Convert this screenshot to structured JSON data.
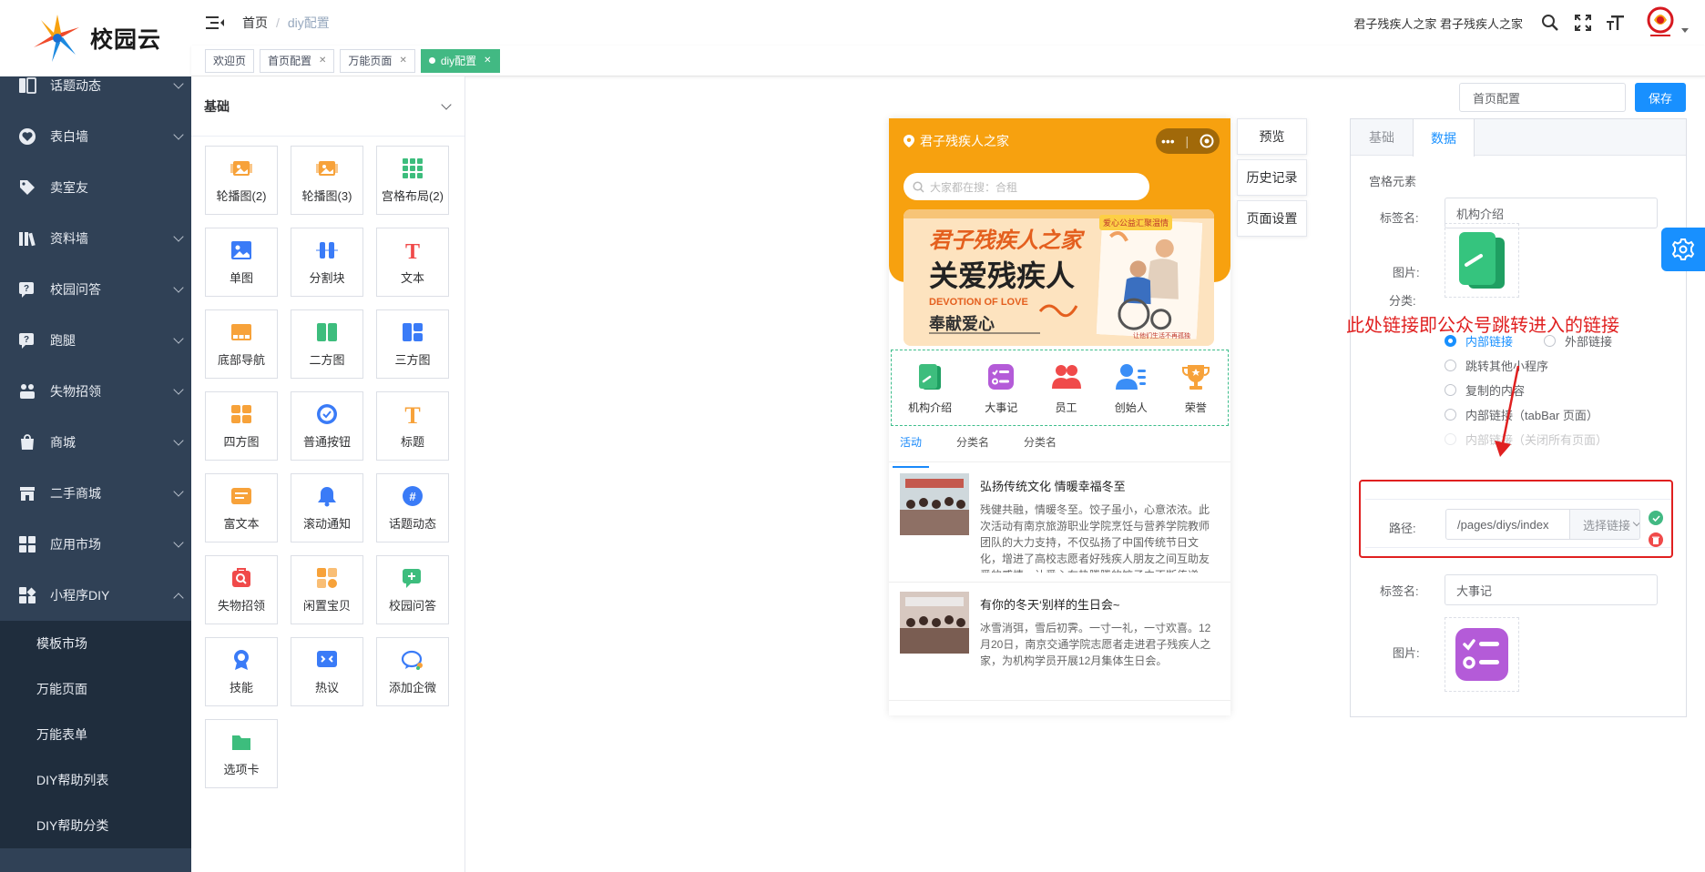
{
  "logo": {
    "text": "校园云"
  },
  "sidebar": {
    "items": [
      {
        "label": "话题动态",
        "icon": "topic-icon",
        "arrow": "down"
      },
      {
        "label": "表白墙",
        "icon": "heart-icon",
        "arrow": "down"
      },
      {
        "label": "卖室友",
        "icon": "tag-icon",
        "arrow": ""
      },
      {
        "label": "资料墙",
        "icon": "books-icon",
        "arrow": "down"
      },
      {
        "label": "校园问答",
        "icon": "qa-icon",
        "arrow": "down"
      },
      {
        "label": "跑腿",
        "icon": "errand-icon",
        "arrow": "down"
      },
      {
        "label": "失物招领",
        "icon": "lost-found-icon",
        "arrow": "down"
      },
      {
        "label": "商城",
        "icon": "shop-icon",
        "arrow": "down"
      },
      {
        "label": "二手商城",
        "icon": "store-icon",
        "arrow": "down"
      },
      {
        "label": "应用市场",
        "icon": "apps-icon",
        "arrow": "down"
      },
      {
        "label": "小程序DIY",
        "icon": "diy-icon",
        "arrow": "up"
      }
    ],
    "subitems": [
      "模板市场",
      "万能页面",
      "万能表单",
      "DIY帮助列表",
      "DIY帮助分类"
    ]
  },
  "header": {
    "breadcrumb": [
      "首页",
      "diy配置"
    ],
    "user_text": "君子残疾人之家 君子残疾人之家"
  },
  "tags": [
    {
      "label": "欢迎页",
      "closable": false,
      "active": false
    },
    {
      "label": "首页配置",
      "closable": true,
      "active": false
    },
    {
      "label": "万能页面",
      "closable": true,
      "active": false
    },
    {
      "label": "diy配置",
      "closable": true,
      "active": true
    }
  ],
  "components": {
    "section": "基础",
    "items": [
      {
        "label": "轮播图(2)",
        "icon": "carousel-icon",
        "color": "#f7a23a"
      },
      {
        "label": "轮播图(3)",
        "icon": "carousel-icon",
        "color": "#f7a23a"
      },
      {
        "label": "宫格布局(2)",
        "icon": "grid-icon",
        "color": "#3dbd7d"
      },
      {
        "label": "单图",
        "icon": "image-icon",
        "color": "#3a7bf7"
      },
      {
        "label": "分割块",
        "icon": "divider-icon",
        "color": "#3a7bf7"
      },
      {
        "label": "文本",
        "icon": "text-icon",
        "color": "#f04a4a"
      },
      {
        "label": "底部导航",
        "icon": "bottom-nav-icon",
        "color": "#f7a23a"
      },
      {
        "label": "二方图",
        "icon": "two-image-icon",
        "color": "#3dbd7d"
      },
      {
        "label": "三方图",
        "icon": "three-image-icon",
        "color": "#3a7bf7"
      },
      {
        "label": "四方图",
        "icon": "four-image-icon",
        "color": "#f7a23a"
      },
      {
        "label": "普通按钮",
        "icon": "button-icon",
        "color": "#3a7bf7"
      },
      {
        "label": "标题",
        "icon": "title-icon",
        "color": "#f7a23a"
      },
      {
        "label": "富文本",
        "icon": "rich-text-icon",
        "color": "#f7a23a"
      },
      {
        "label": "滚动通知",
        "icon": "bell-icon",
        "color": "#3a7bf7"
      },
      {
        "label": "话题动态",
        "icon": "hashtag-icon",
        "color": "#3a7bf7"
      },
      {
        "label": "失物招领",
        "icon": "lost-found-icon",
        "color": "#f04a4a"
      },
      {
        "label": "闲置宝贝",
        "icon": "idle-icon",
        "color": "#f7a23a"
      },
      {
        "label": "校园问答",
        "icon": "chat-plus-icon",
        "color": "#3dbd7d"
      },
      {
        "label": "技能",
        "icon": "badge-icon",
        "color": "#3a7bf7"
      },
      {
        "label": "热议",
        "icon": "hot-icon",
        "color": "#3a7bf7"
      },
      {
        "label": "添加企微",
        "icon": "wecom-icon",
        "color": "#3a7bf7"
      },
      {
        "label": "选项卡",
        "icon": "tabs-icon",
        "color": "#3dbd7d"
      }
    ]
  },
  "phone": {
    "location": "君子残疾人之家",
    "search_placeholder": "大家都在搜：合租",
    "banner": {
      "badge": "爱心公益汇聚温情",
      "line1": "君子残疾人之家",
      "line2": "关爱残疾人",
      "line3": "DEVOTION OF LOVE",
      "line4": "奉献爱心",
      "footnote": "让他们生活不再孤独"
    },
    "icons": [
      {
        "label": "机构介绍",
        "color": "#3dbd7d"
      },
      {
        "label": "大事记",
        "color": "#b45bd8"
      },
      {
        "label": "员工",
        "color": "#f04a4a"
      },
      {
        "label": "创始人",
        "color": "#3a8ef7"
      },
      {
        "label": "荣誉",
        "color": "#f7a23a"
      }
    ],
    "tabs": [
      "活动",
      "分类名",
      "分类名"
    ],
    "news": [
      {
        "title": "弘扬传统文化 情暖幸福冬至",
        "desc": "残健共融，情暖冬至。饺子虽小，心意浓浓。此次活动有南京旅游职业学院烹饪与营养学院教师团队的大力支持，不仅弘扬了中国传统节日文化，增进了高校志愿者好残疾人朋友之间互助友爱的感情，让爱心在热腾腾的饺子中不断传递，为机构学员们的生活增添了色彩。"
      },
      {
        "title": "有你的冬天‘别样的生日会~",
        "desc": "冰雪消弭，雪后初霁。一寸一礼，一寸欢喜。12月20日，南京交通学院志愿者走进君子残疾人之家，为机构学员开展12月集体生日会。"
      }
    ]
  },
  "preview_buttons": [
    "预览",
    "历史记录",
    "页面设置"
  ],
  "top": {
    "page_select": "首页配置",
    "save": "保存"
  },
  "panel": {
    "tabs": [
      "基础",
      "数据"
    ],
    "active_tab": 1,
    "section": "宫格元素",
    "tag_label": "标签名:",
    "tag_value_1": "机构介绍",
    "image_label": "图片:",
    "category_label": "分类:",
    "radios": [
      {
        "label": "内部链接",
        "on": true
      },
      {
        "label": "外部链接",
        "on": false
      },
      {
        "label": "跳转其他小程序",
        "on": false
      },
      {
        "label": "复制的内容",
        "on": false
      },
      {
        "label": "内部链接（tabBar 页面）",
        "on": false
      },
      {
        "label": "内部链接（关闭所有页面）",
        "on": false
      }
    ],
    "path_label": "路径:",
    "path_value": "/pages/diys/index",
    "path_select": "选择链接",
    "tag_value_2": "大事记",
    "image_label_2": "图片:"
  },
  "annotation": "此处链接即公众号跳转进入的链接",
  "colors": {
    "sidebar": "#304156",
    "accent": "#1890ff",
    "tag_active": "#42b983",
    "phone_top": "#f7a10f",
    "annotation": "#e02020"
  }
}
